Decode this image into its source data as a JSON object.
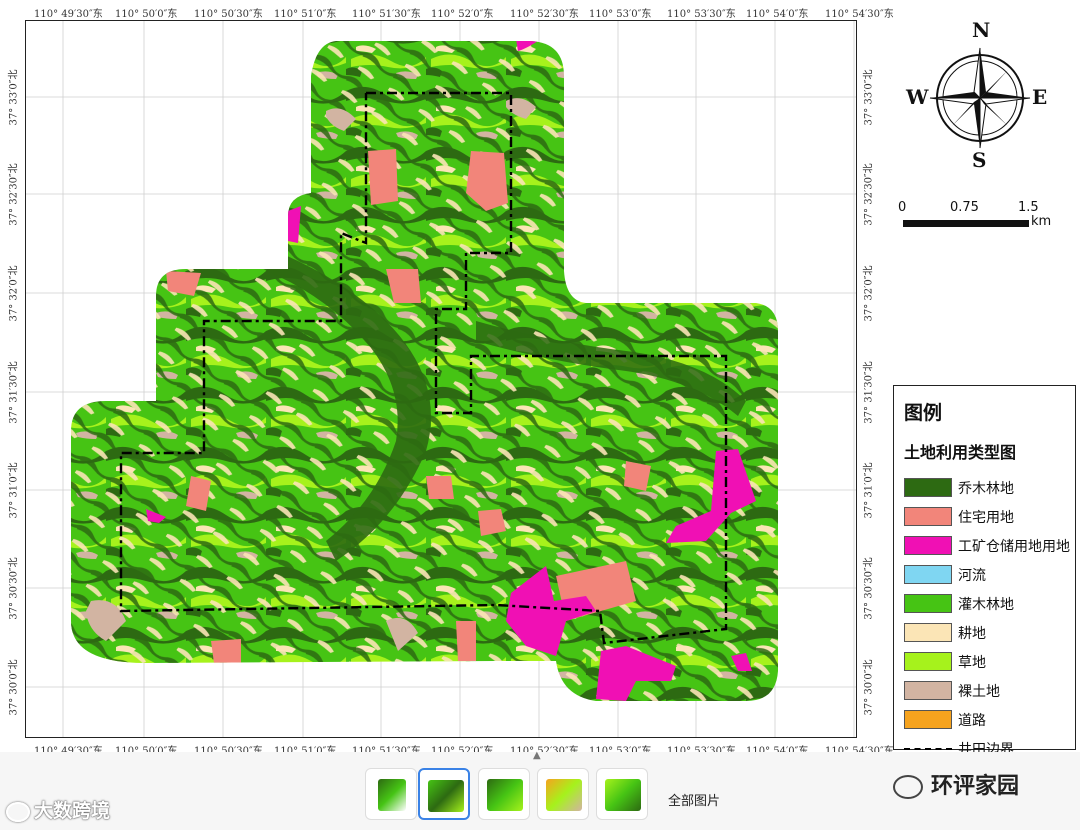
{
  "map": {
    "top_lon_labels": [
      "110° 49′30″东",
      "110° 50′0″东",
      "110° 50′30″东",
      "110° 51′0″东",
      "110° 51′30″东",
      "110° 52′0″东",
      "110° 52′30″东",
      "110° 53′0″东",
      "110° 53′30″东",
      "110° 54′0″东",
      "110° 54′30″东"
    ],
    "bottom_lon_labels": [
      "110° 49′30″东",
      "110° 50′0″东",
      "110° 50′30″东",
      "110° 51′0″东",
      "110° 51′30″东",
      "110° 52′0″东",
      "110° 52′30″东",
      "110° 53′0″东",
      "110° 53′30″东",
      "110° 54′0″东",
      "110° 54′30″东"
    ],
    "lat_labels": [
      "37° 33′0″北",
      "37° 32′30″北",
      "37° 32′0″北",
      "37° 31′30″北",
      "37° 31′0″北",
      "37° 30′30″北",
      "37° 30′0″北"
    ]
  },
  "compass": {
    "n": "N",
    "s": "S",
    "e": "E",
    "w": "W"
  },
  "scale_bar": {
    "labels": [
      "0",
      "0.75",
      "1.5"
    ],
    "unit": "km"
  },
  "legend": {
    "title": "图例",
    "subtitle": "土地利用类型图",
    "items": [
      {
        "label": "乔木林地",
        "color": "#2d6a12"
      },
      {
        "label": "住宅用地",
        "color": "#f2857a"
      },
      {
        "label": "工矿仓储用地用地",
        "color": "#f010b4"
      },
      {
        "label": "河流",
        "color": "#7fd6f2"
      },
      {
        "label": "灌木林地",
        "color": "#46c414"
      },
      {
        "label": "耕地",
        "color": "#fbe5b6"
      },
      {
        "label": "草地",
        "color": "#a6f21c"
      },
      {
        "label": "裸土地",
        "color": "#d2b4a2"
      },
      {
        "label": "道路",
        "color": "#f6a31e"
      }
    ],
    "boundary_label": "井田边界"
  },
  "bottom_bar": {
    "all_images_label": "全部图片"
  },
  "watermarks": {
    "left": "大数跨境",
    "right": "环评家园"
  }
}
